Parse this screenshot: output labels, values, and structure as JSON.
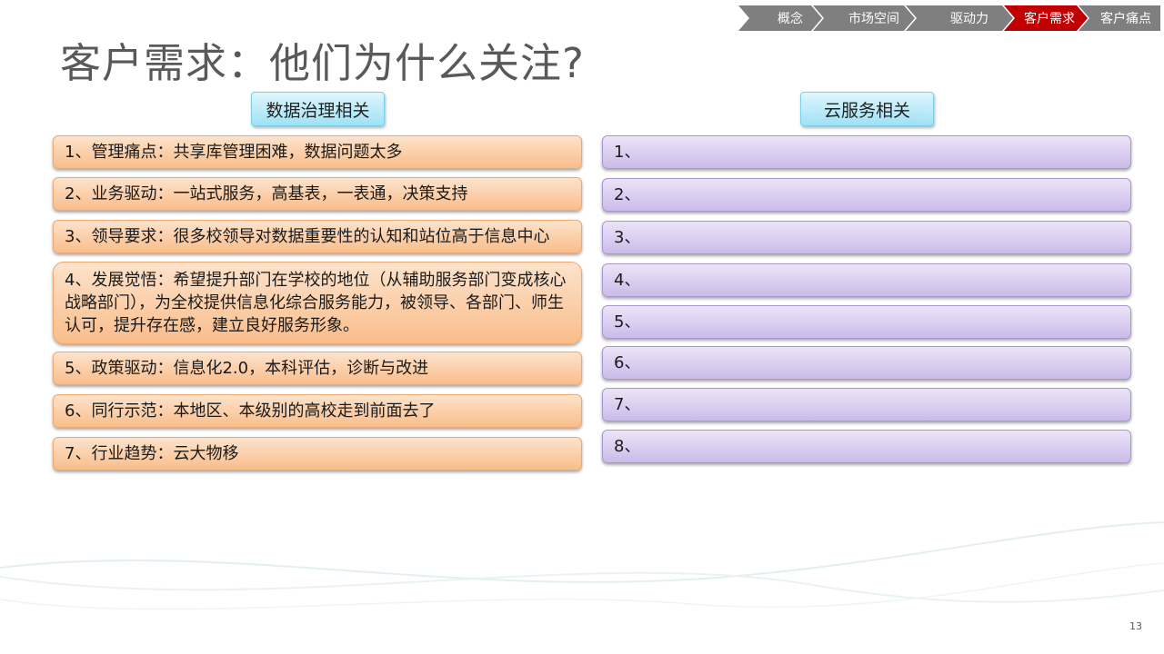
{
  "breadcrumbs": [
    {
      "label": "概念",
      "active": false
    },
    {
      "label": "市场空间",
      "active": false
    },
    {
      "label": "驱动力",
      "active": false
    },
    {
      "label": "客户需求",
      "active": true
    },
    {
      "label": "客户痛点",
      "active": false
    }
  ],
  "title": "客户需求：他们为什么关注?",
  "left_column": {
    "header": "数据治理相关",
    "items": [
      "1、管理痛点：共享库管理困难，数据问题太多",
      "2、业务驱动：一站式服务，高基表，一表通，决策支持",
      "3、领导要求：很多校领导对数据重要性的认知和站位高于信息中心",
      "4、发展觉悟：希望提升部门在学校的地位（从辅助服务部门变成核心战略部门），为全校提供信息化综合服务能力，被领导、各部门、师生认可，提升存在感，建立良好服务形象。",
      "5、政策驱动：信息化2.0，本科评估，诊断与改进",
      "6、同行示范：本地区、本级别的高校走到前面去了",
      "7、行业趋势：云大物移"
    ]
  },
  "right_column": {
    "header": "云服务相关",
    "items": [
      "1、",
      "2、",
      "3、",
      "4、",
      "5、",
      "6、",
      "7、",
      "8、"
    ]
  },
  "page_number": "13",
  "colors": {
    "breadcrumb_inactive": "#7f7f7f",
    "breadcrumb_active": "#c00000",
    "left_item_fill": "#fbcfa6",
    "right_item_fill": "#dcd0f0",
    "header_fill": "#bdebf9",
    "title": "#595959"
  }
}
